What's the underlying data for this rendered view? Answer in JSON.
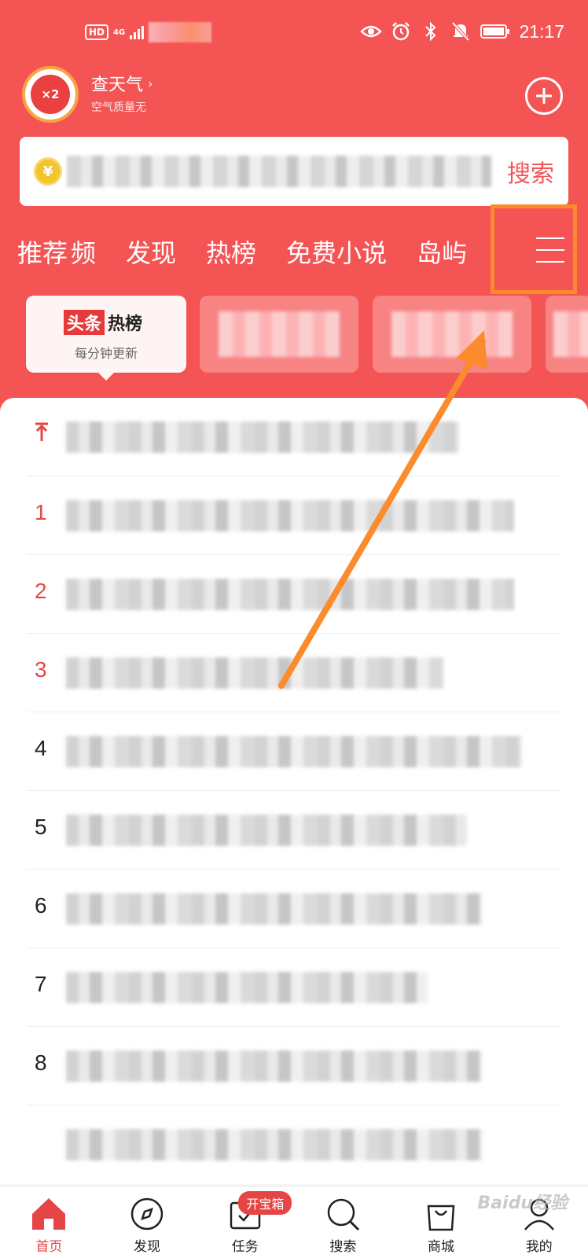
{
  "colors": {
    "brand_red": "#f45454",
    "accent_orange": "#fb8b2d",
    "rank_red": "#e64545"
  },
  "status_bar": {
    "time": "21:17",
    "hd": "HD",
    "network": "4G"
  },
  "weather": {
    "title": "查天气",
    "subtitle": "空气质量无",
    "avatar_badge": "×2"
  },
  "search": {
    "coin_symbol": "¥",
    "button_label": "搜索"
  },
  "tabs": [
    "推荐",
    "频",
    "发现",
    "热榜",
    "免费小说",
    "岛屿"
  ],
  "category": {
    "logo_part1": "头条",
    "logo_part2": "热榜",
    "subtitle": "每分钟更新"
  },
  "hot_list": {
    "ranks": [
      "",
      "1",
      "2",
      "3",
      "4",
      "5",
      "6",
      "7",
      "8",
      ""
    ]
  },
  "bottom_nav": [
    {
      "label": "首页",
      "icon": "home-icon",
      "active": true
    },
    {
      "label": "发现",
      "icon": "compass-icon"
    },
    {
      "label": "任务",
      "icon": "task-icon",
      "badge": "开宝箱"
    },
    {
      "label": "搜索",
      "icon": "search-icon"
    },
    {
      "label": "商城",
      "icon": "shopping-bag-icon"
    },
    {
      "label": "我的",
      "icon": "user-icon"
    }
  ],
  "watermark": "Baidu经验"
}
